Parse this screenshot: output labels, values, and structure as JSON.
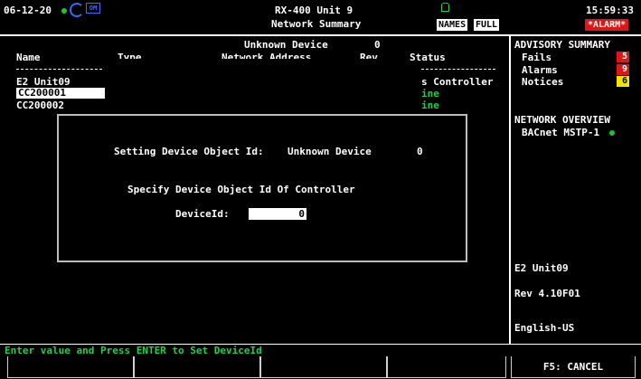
{
  "header": {
    "date": "06-12-20",
    "controller_name": "RX-400 Unit 9",
    "screen_name": "Network Summary",
    "names_btn": "NAMES",
    "full_btn": "FULL",
    "time": "15:59:33",
    "alarm": "*ALARM*"
  },
  "table": {
    "top_label": "Unknown Device",
    "top_count": "0",
    "col_name": "Name",
    "col_type": "Type",
    "col_addr": "Network Address",
    "col_rev": "Rev",
    "col_status": "Status",
    "rows": [
      {
        "name": "E2 Unit09",
        "status": "s Controller"
      },
      {
        "name": "CC200001",
        "status": "ine"
      },
      {
        "name": "CC200002",
        "status": "ine"
      }
    ]
  },
  "dialog": {
    "line1_label": "Setting Device Object Id:",
    "line1_device": "Unknown Device",
    "line1_value": "0",
    "line2": "Specify Device Object Id Of Controller",
    "field_label": "DeviceId:",
    "field_value": "0"
  },
  "sidebar": {
    "advisory_title": "ADVISORY SUMMARY",
    "fails_label": "Fails",
    "fails_count": "5",
    "alarms_label": "Alarms",
    "alarms_count": "9",
    "notices_label": "Notices",
    "notices_count": "6",
    "network_title": "NETWORK OVERVIEW",
    "network_item": "BACnet MSTP-1",
    "unit_name": "E2 Unit09",
    "revision": "Rev 4.10F01",
    "language": "English-US"
  },
  "footer": {
    "status_message": "Enter value and Press ENTER to Set DeviceId",
    "f5_label": "F5: CANCEL"
  },
  "colors": {
    "ok_green": "#19d34a",
    "fail_red": "#e01515",
    "notice_yellow": "#f2e600"
  }
}
